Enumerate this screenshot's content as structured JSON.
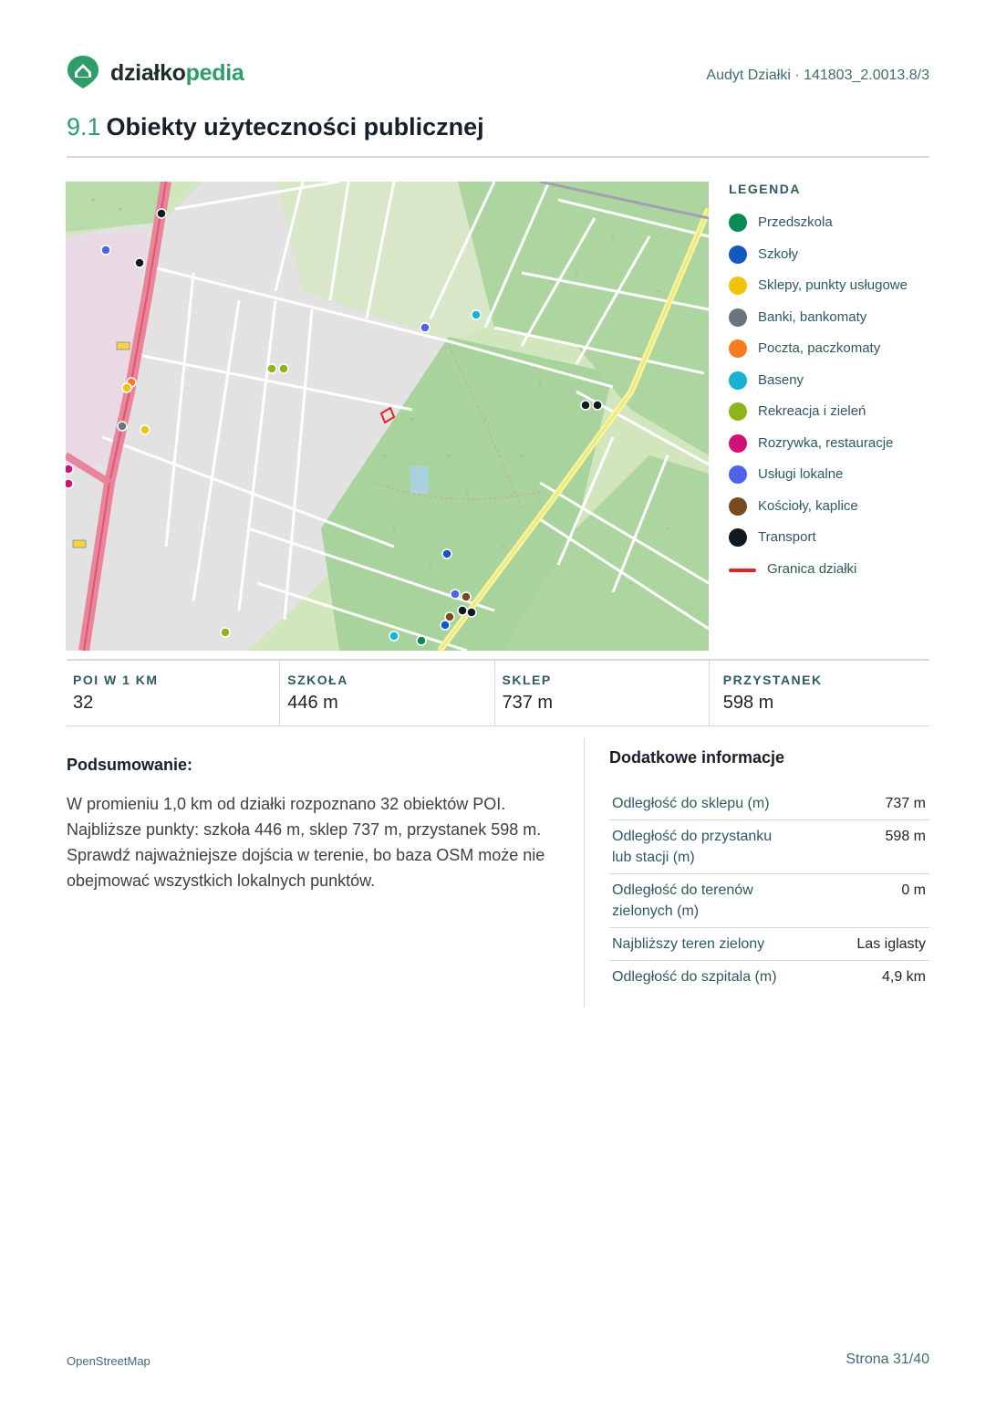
{
  "brand": {
    "name_a": "działko",
    "name_b": "pedia"
  },
  "header": {
    "audit_label": "Audyt Działki · 141803_2.0013.8/3"
  },
  "section": {
    "number": "9.1",
    "title": "Obiekty użyteczności publicznej"
  },
  "legend": {
    "title": "LEGENDA",
    "items": [
      {
        "label": "Przedszkola",
        "color": "#0b8a55"
      },
      {
        "label": "Szkoły",
        "color": "#1557c0"
      },
      {
        "label": "Sklepy, punkty usługowe",
        "color": "#f0c30f"
      },
      {
        "label": "Banki, bankomaty",
        "color": "#6b7280"
      },
      {
        "label": "Poczta, paczkomaty",
        "color": "#f57c1f"
      },
      {
        "label": "Baseny",
        "color": "#16b1d3"
      },
      {
        "label": "Rekreacja i zieleń",
        "color": "#8db51a"
      },
      {
        "label": "Rozrywka, restauracje",
        "color": "#d0117a"
      },
      {
        "label": "Usługi lokalne",
        "color": "#4f63e8"
      },
      {
        "label": "Kościoły, kaplice",
        "color": "#7a4a1e"
      },
      {
        "label": "Transport",
        "color": "#111820"
      }
    ],
    "boundary": {
      "label": "Granica działki",
      "color": "#e3242b"
    }
  },
  "stats": [
    {
      "label": "POI W 1 KM",
      "value": "32"
    },
    {
      "label": "SZKOŁA",
      "value": "446 m"
    },
    {
      "label": "SKLEP",
      "value": "737 m"
    },
    {
      "label": "PRZYSTANEK",
      "value": "598 m"
    }
  ],
  "summary": {
    "title": "Podsumowanie:",
    "text": "W promieniu 1,0 km od działki rozpoznano 32 obiektów POI. Najbliższe punkty: szkoła 446 m, sklep 737 m, przystanek 598 m. Sprawdź najważniejsze dojścia w terenie, bo baza OSM może nie obejmować wszystkich lokalnych punktów."
  },
  "extra": {
    "title": "Dodatkowe informacje",
    "rows": [
      {
        "label": "Odległość do sklepu (m)",
        "value": "737 m"
      },
      {
        "label": "Odległość do przystanku lub stacji (m)",
        "value": "598 m"
      },
      {
        "label": "Odległość do terenów zielonych (m)",
        "value": "0 m"
      },
      {
        "label": "Najbliższy teren zielony",
        "value": "Las iglasty"
      },
      {
        "label": "Odległość do szpitala (m)",
        "value": "4,9 km"
      }
    ]
  },
  "footer": {
    "source": "OpenStreetMap",
    "page": "Strona 31/40"
  }
}
